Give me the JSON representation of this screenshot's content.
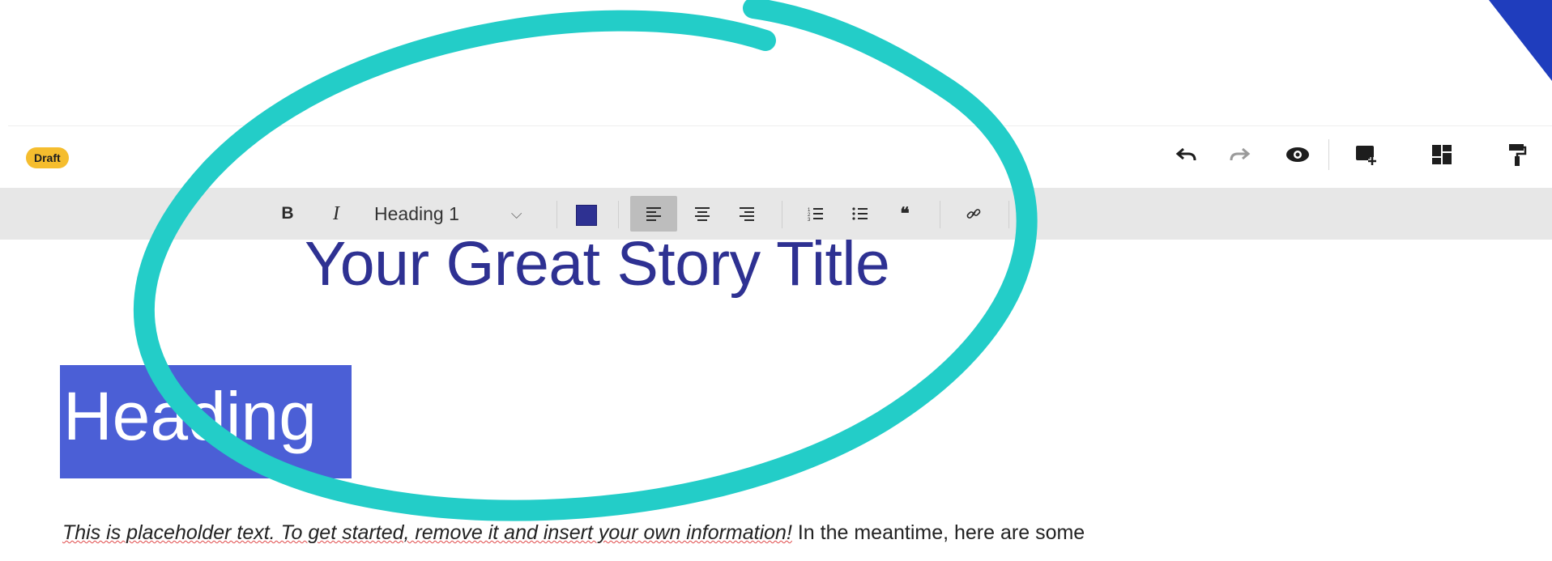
{
  "status": {
    "draft_label": "Draft"
  },
  "header_actions": {
    "undo_icon": "undo-icon",
    "redo_icon": "redo-icon",
    "preview_icon": "eye-icon",
    "add_block_icon": "add-block-icon",
    "layout_icon": "layout-grid-icon",
    "format_painter_icon": "paint-roller-icon"
  },
  "toolbar": {
    "bold": "B",
    "italic": "I",
    "text_style": "Heading 1",
    "text_color": "#2e3192",
    "align_left": "≡",
    "align_center": "≡",
    "align_right": "≡",
    "ordered_list": "⒈≡",
    "bullet_list": "•≡",
    "quote": "❝",
    "link": "🔗"
  },
  "document": {
    "title": "Your Great Story Title",
    "heading": "Heading",
    "placeholder_italic": "This is placeholder text. To get started, remove it and insert your own information!",
    "placeholder_rest": " In the meantime, here are some"
  },
  "colors": {
    "accent_blue": "#2e3192",
    "heading_highlight": "#4b5fd6",
    "draft_badge": "#f5bd2e",
    "annotation_teal": "#23cdc8"
  }
}
